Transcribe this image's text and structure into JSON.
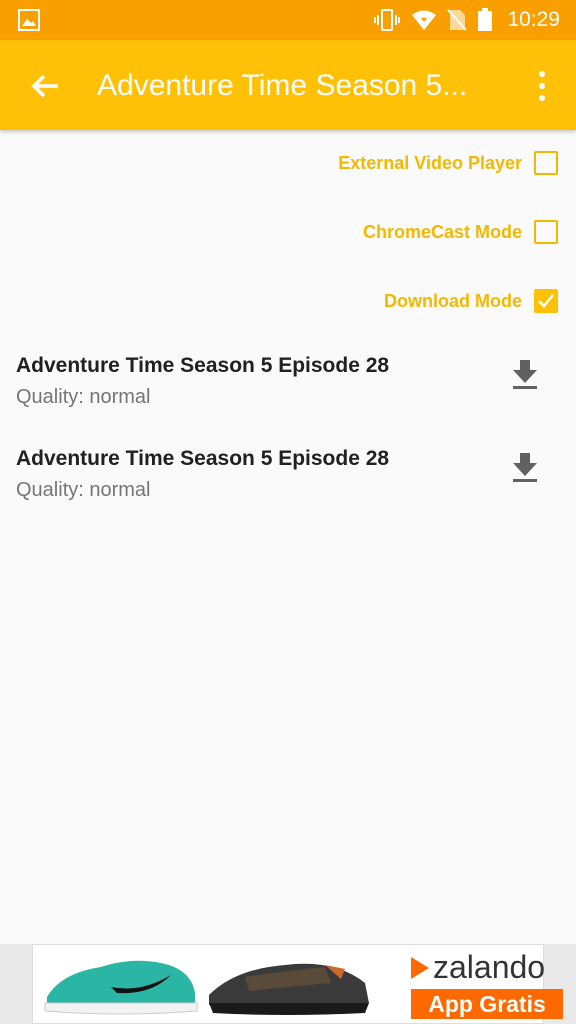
{
  "status_bar": {
    "time": "10:29",
    "icons": [
      "gallery-icon",
      "vibrate-icon",
      "wifi-icon",
      "no-sim-icon",
      "battery-icon"
    ]
  },
  "app_bar": {
    "title": "Adventure Time Season 5...",
    "background": "#FFC107"
  },
  "options": [
    {
      "label": "External Video Player",
      "checked": false
    },
    {
      "label": "ChromeCast Mode",
      "checked": false
    },
    {
      "label": "Download Mode",
      "checked": true
    }
  ],
  "episodes": [
    {
      "title": "Adventure Time Season 5 Episode 28",
      "quality": "Quality: normal"
    },
    {
      "title": "Adventure Time Season 5 Episode 28",
      "quality": "Quality: normal"
    }
  ],
  "ad": {
    "brand": "zalando",
    "cta": "App Gratis"
  },
  "colors": {
    "accent": "#FFC107",
    "status_bar": "#F9A000",
    "option_text": "#F5B800",
    "ad_orange": "#FF6900"
  }
}
